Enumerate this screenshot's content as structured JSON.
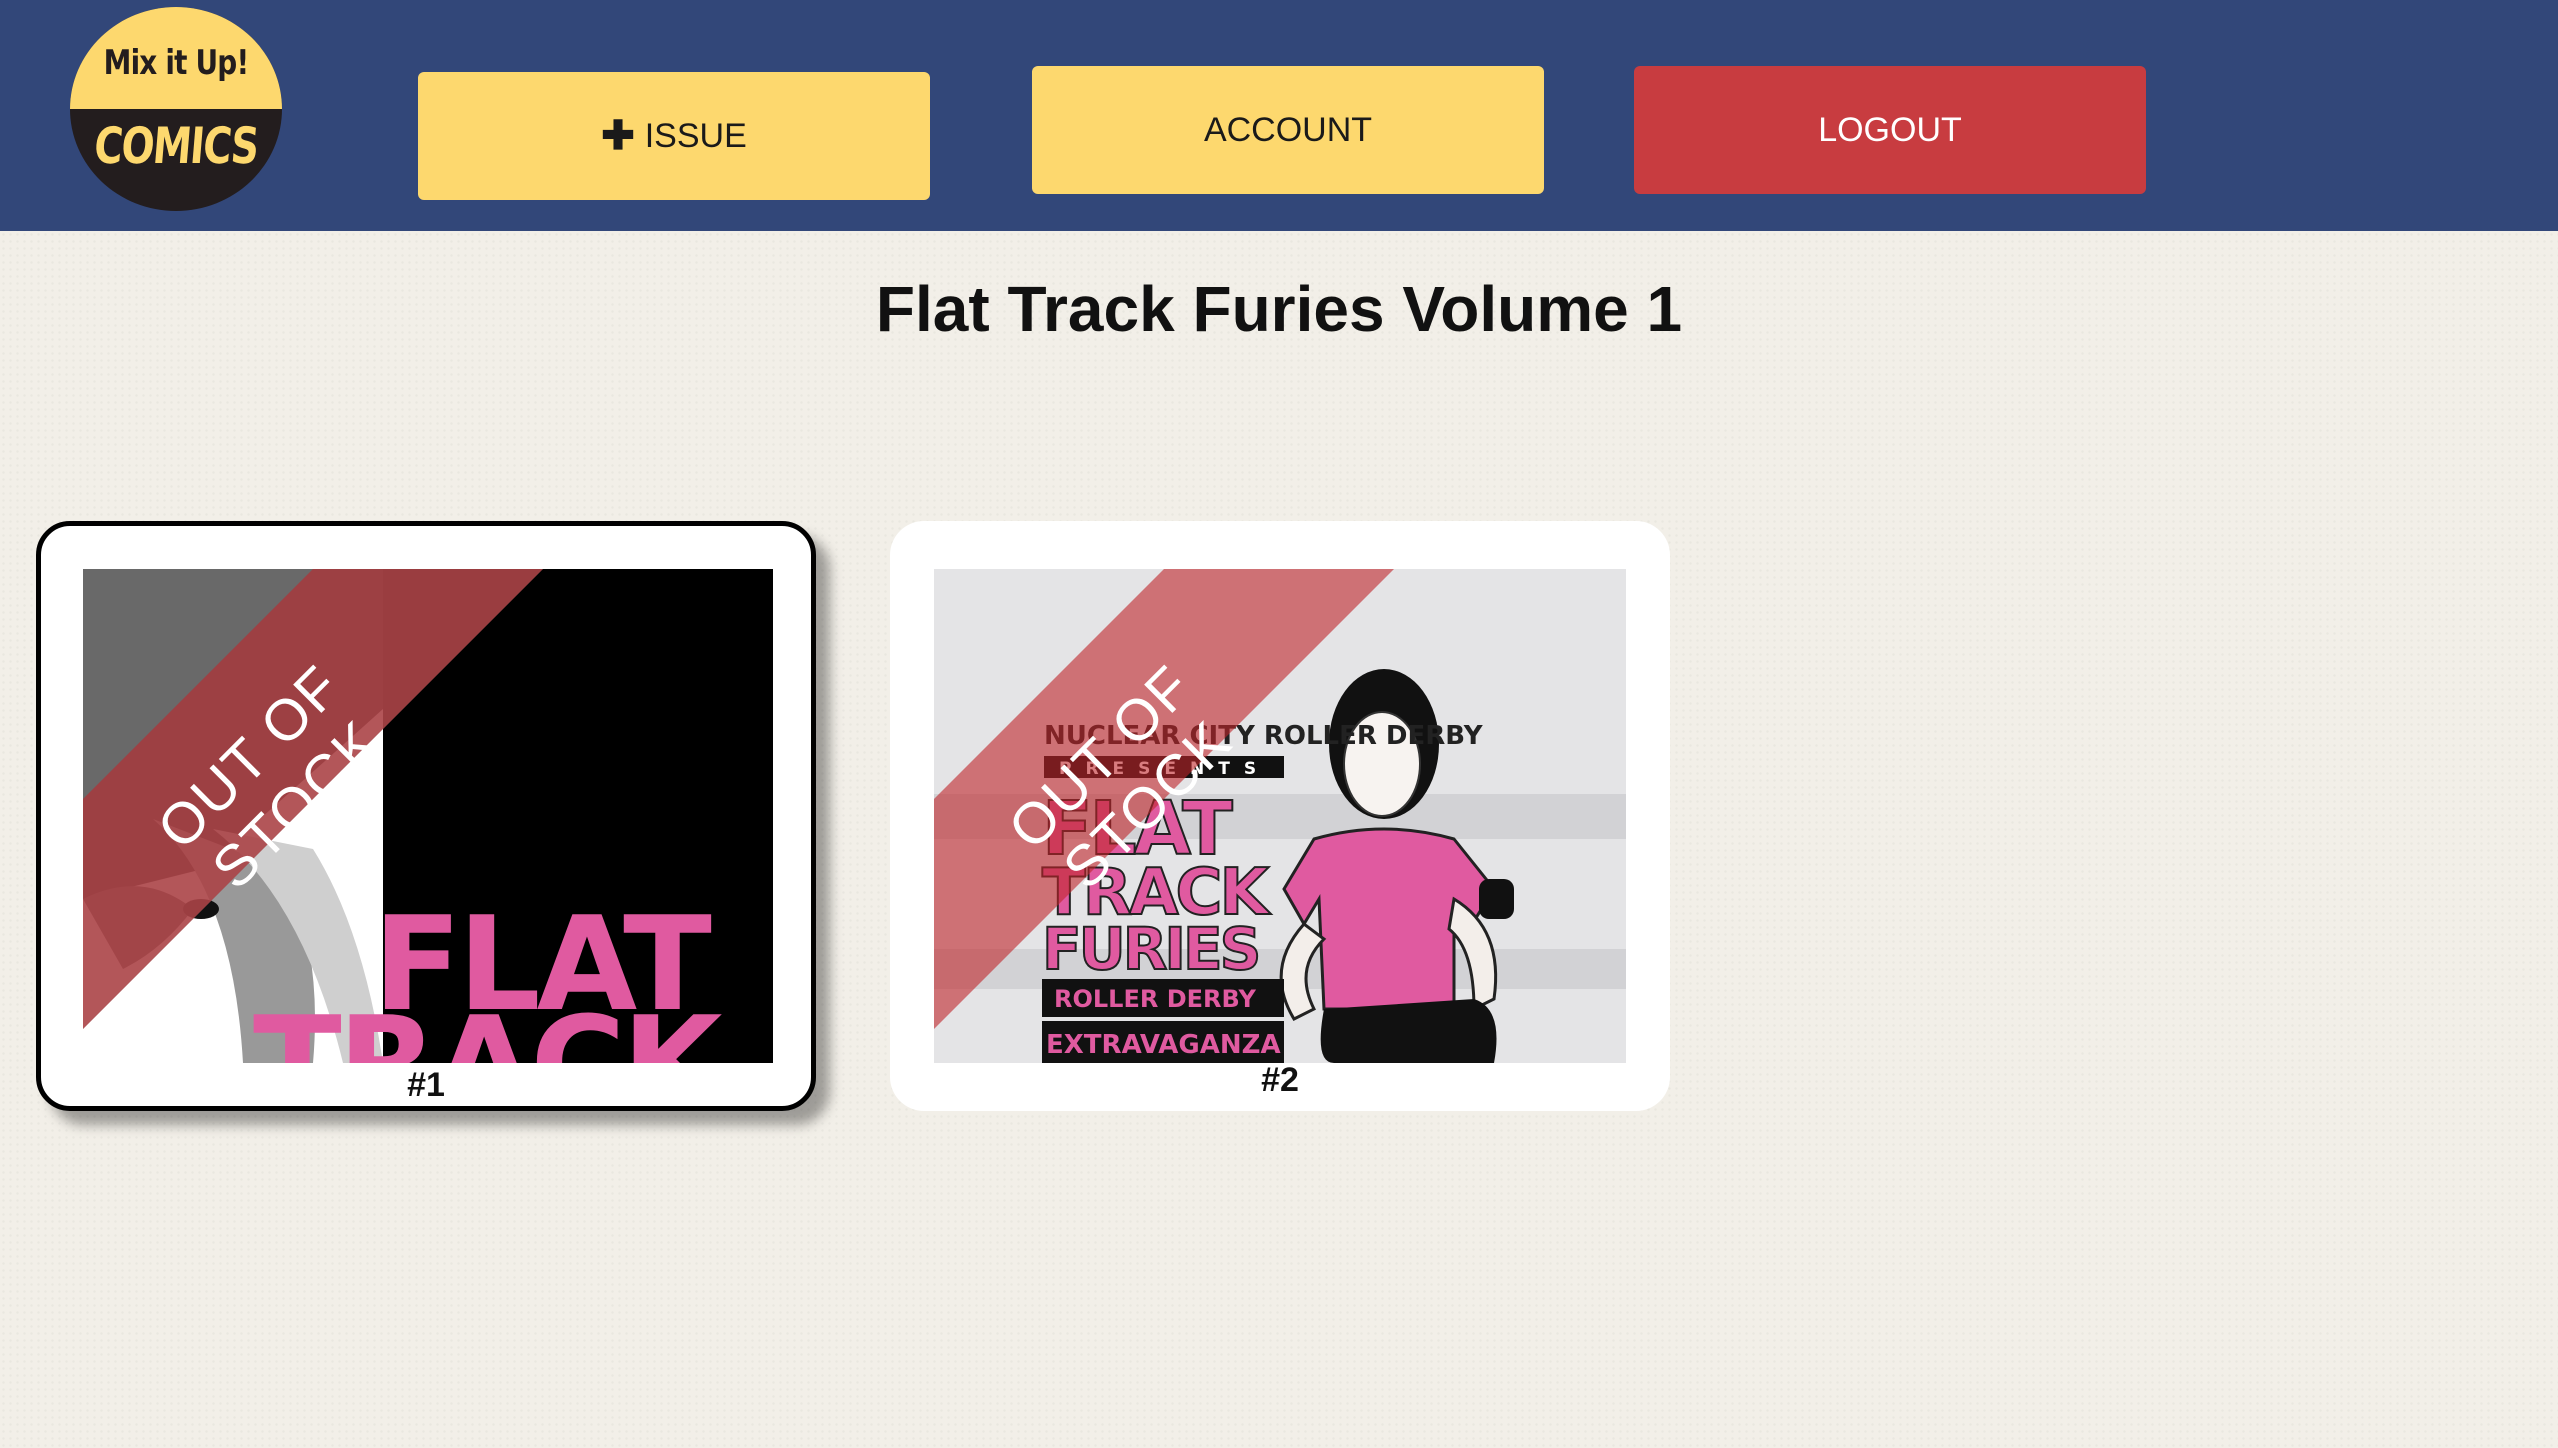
{
  "header": {
    "logo_line1": "Mix it Up!",
    "logo_line2": "COMICS",
    "add_issue_label": "ISSUE",
    "account_label": "ACCOUNT",
    "logout_label": "LOGOUT"
  },
  "page_title": "Flat Track Furies Volume 1",
  "issues": [
    {
      "label": "#1",
      "status": "OUT OF STOCK",
      "cover_text": [
        "FLAT",
        "TRACK"
      ],
      "selected": true
    },
    {
      "label": "#2",
      "status": "OUT OF STOCK",
      "cover_text": [
        "NUCLEAR CITY ROLLER DERBY",
        "PRESENTS",
        "FLAT",
        "TRACK",
        "FURIES",
        "ROLLER DERBY",
        "EXTRAVAGANZA"
      ],
      "selected": false
    }
  ],
  "colors": {
    "header_bg": "#324779",
    "accent_yellow": "#fdd86e",
    "danger_red": "#c83c40",
    "page_bg": "#f2efe8",
    "cover_pink": "#e05aa0",
    "banner_red": "#c0242a"
  },
  "icons": {
    "add_issue": "plus-icon"
  }
}
